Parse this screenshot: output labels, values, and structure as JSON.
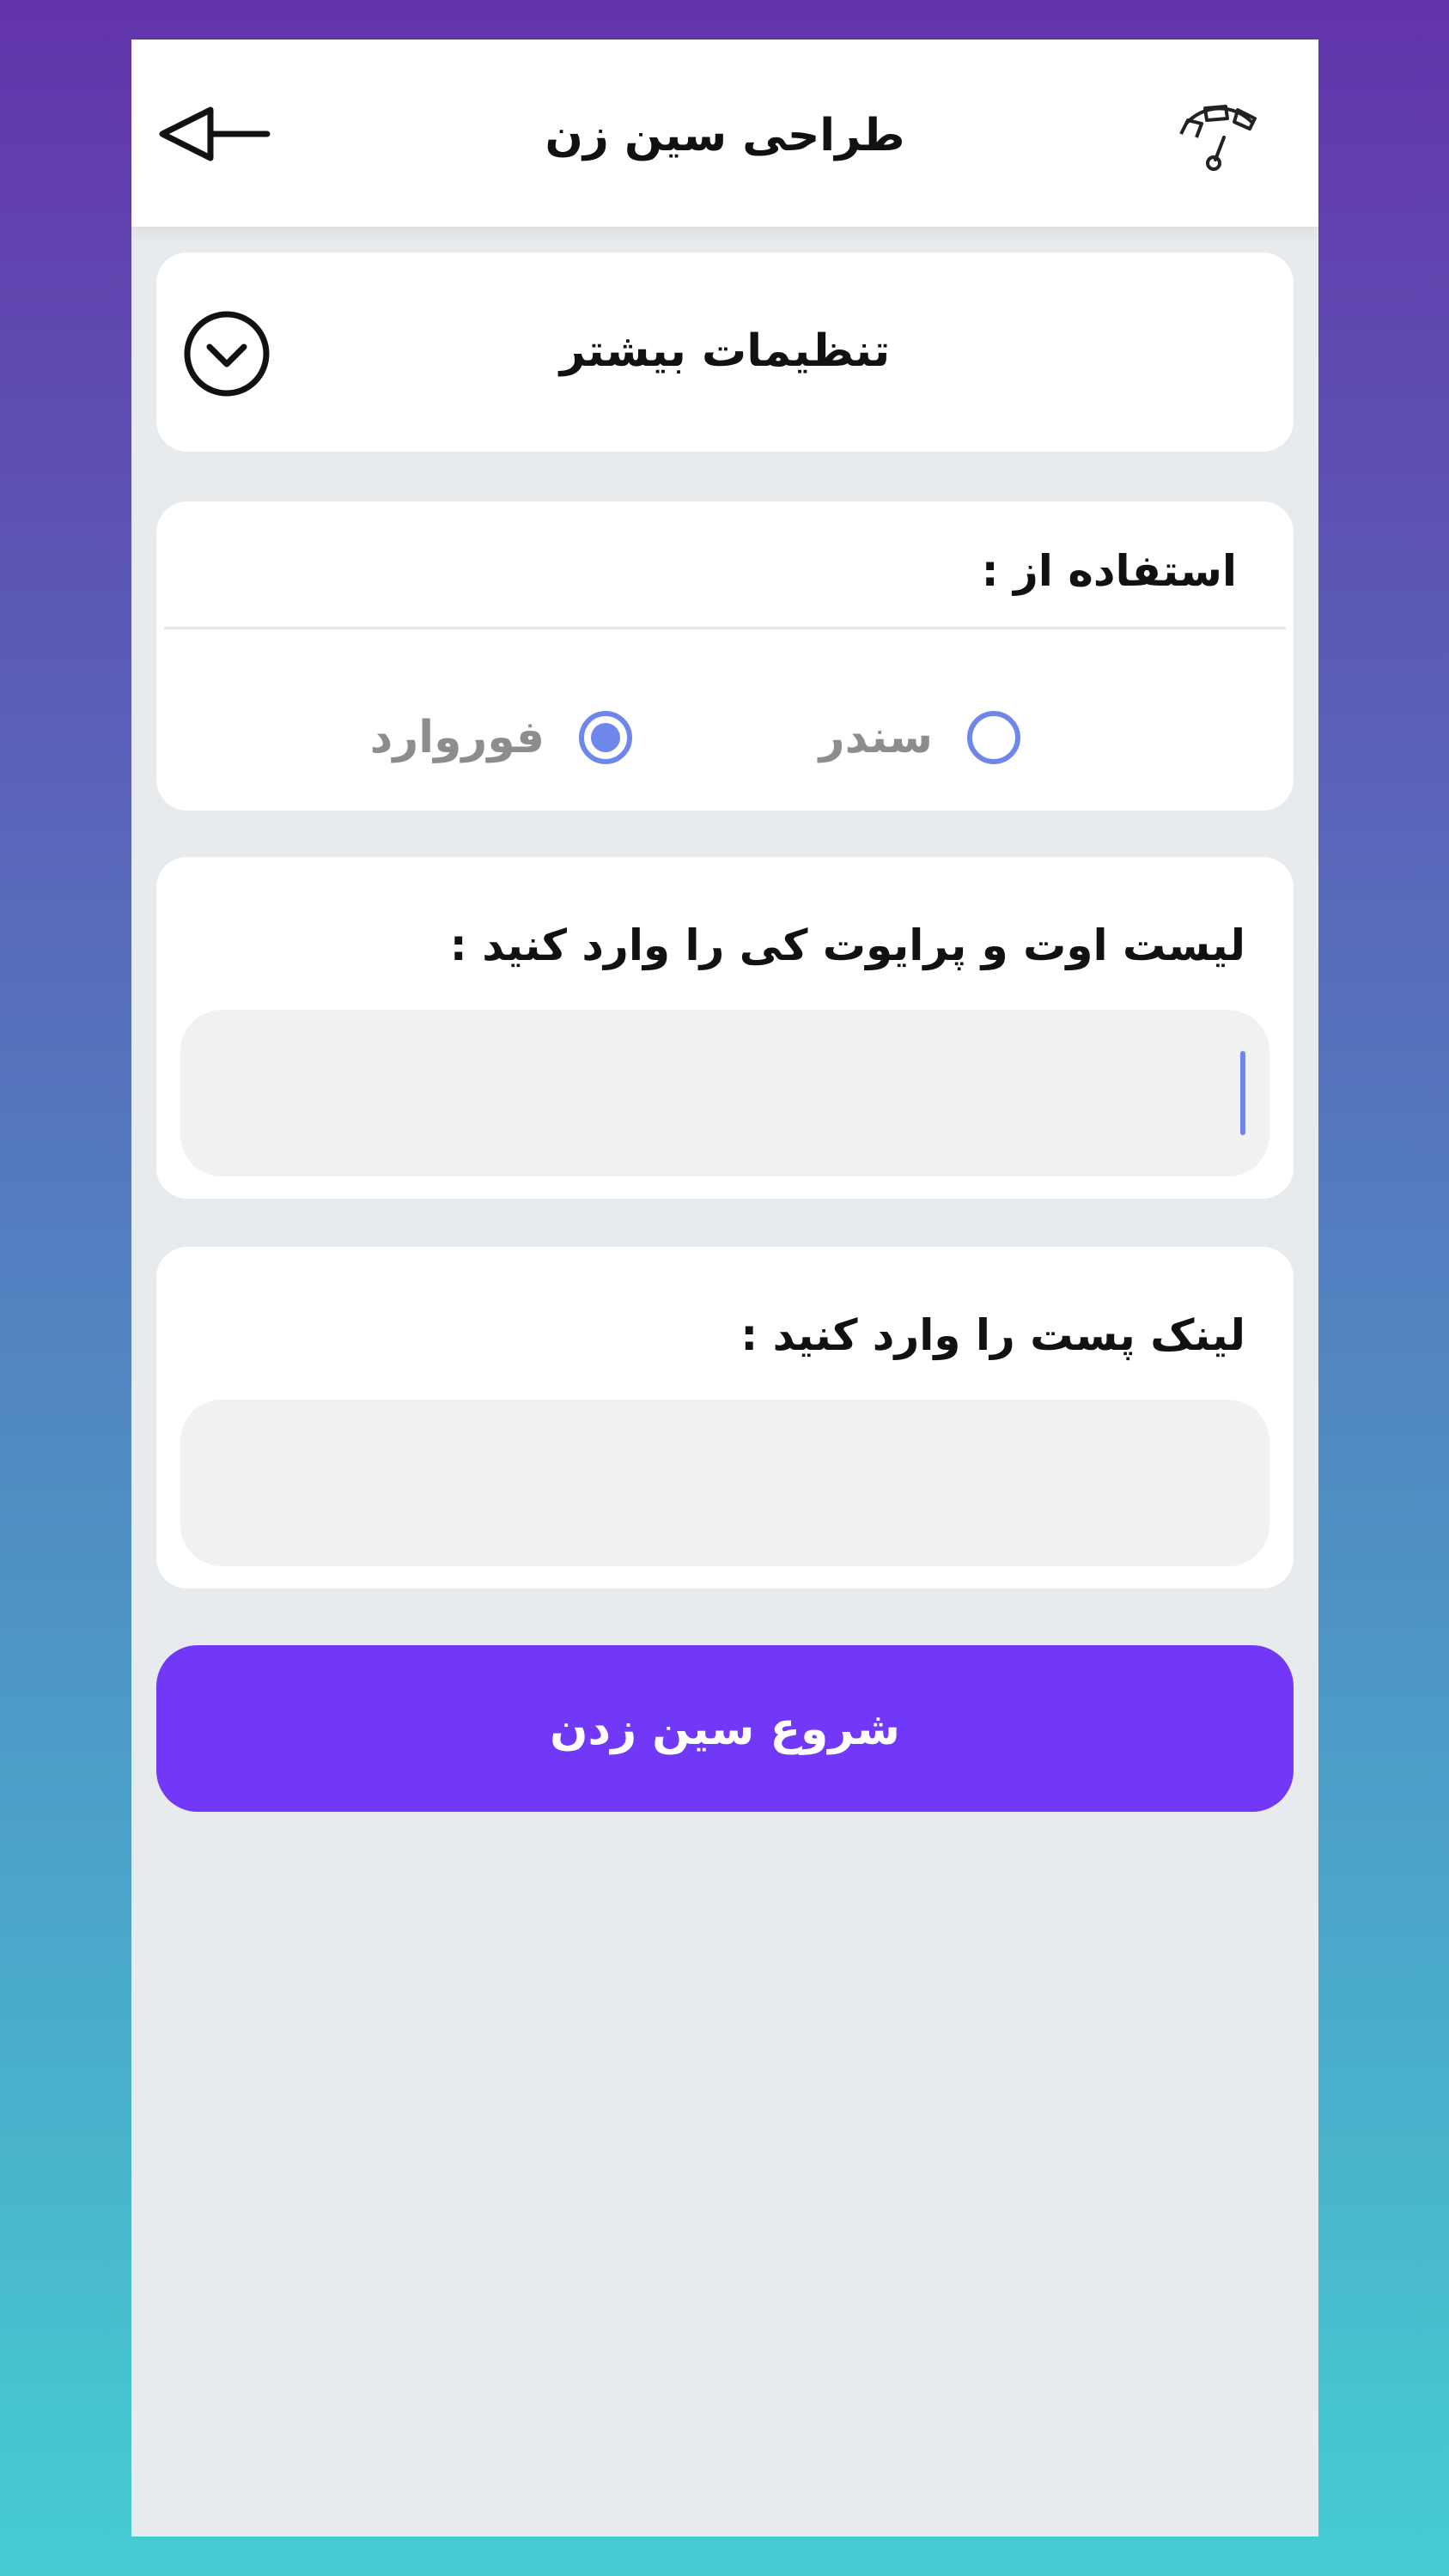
{
  "app": {
    "title": "طراحی سین زن",
    "back_icon": "back-arrow-icon",
    "header_right_icon": "gauge-icon"
  },
  "more_settings": {
    "label": "تنظیمات بیشتر",
    "icon": "chevron-down-circle-icon"
  },
  "usage": {
    "label": "استفاده از :",
    "options": [
      {
        "label": "سندر",
        "selected": false
      },
      {
        "label": "فوروارد",
        "selected": true
      }
    ]
  },
  "private_list": {
    "label": "لیست اوت و پرایوت کی را وارد کنید :",
    "value": ""
  },
  "post_link": {
    "label": "لینک پست را وارد کنید :",
    "value": ""
  },
  "start_button": {
    "label": "شروع سین زدن"
  },
  "colors": {
    "accent": "#7138f7",
    "radio": "#6f86ea",
    "screen_background": "#e8ebee",
    "field_background": "#f0f1f2"
  }
}
